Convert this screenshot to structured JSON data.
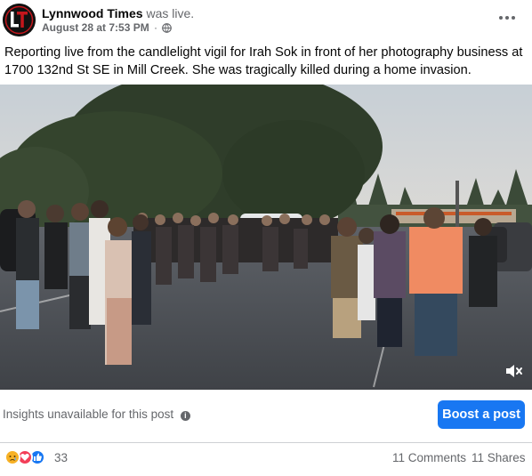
{
  "post": {
    "author": "Lynnwood Times",
    "action": "was live.",
    "avatar_initials": "LT",
    "date": "August 28 at 7:53 PM",
    "separator": "·",
    "audience_icon": "globe-icon",
    "more_icon": "more-options-icon",
    "text": "Reporting live from the candlelight vigil for Irah Sok in front of her photography business at 1700 132nd St SE in Mill Creek. She was tragically killed during a home invasion."
  },
  "video": {
    "mute_icon": "speaker-muted-icon"
  },
  "insights": {
    "text": "Insights unavailable for this post",
    "info_icon": "info-icon",
    "info_glyph": "i",
    "boost_label": "Boost a post"
  },
  "engagement": {
    "reactions": [
      "sad",
      "love",
      "like"
    ],
    "reaction_count": "33",
    "comments": "11 Comments",
    "shares": "11 Shares"
  },
  "colors": {
    "accent": "#1877f2",
    "secondary_text": "#65676b",
    "love": "#f33e58",
    "sad": "#f7b125"
  }
}
